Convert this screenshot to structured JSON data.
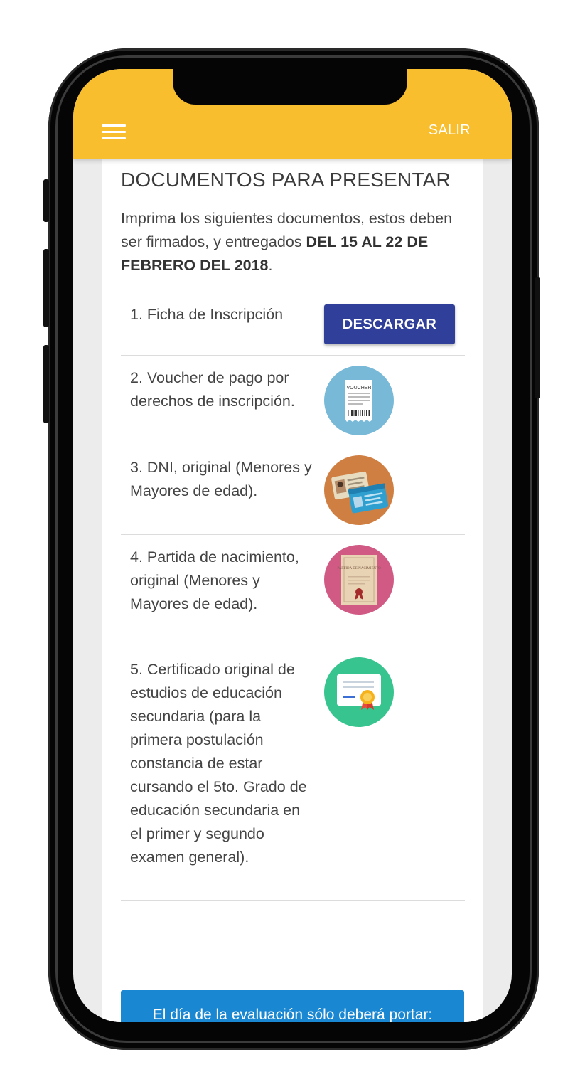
{
  "header": {
    "menu_icon": "hamburger-menu-icon",
    "logout_label": "SALIR",
    "color": "#f8be2e"
  },
  "page": {
    "title": "DOCUMENTOS PARA PRESENTAR",
    "intro_prefix": "Imprima los siguientes documentos, estos deben ser firmados, y entregados ",
    "intro_bold": "DEL 15 AL 22 DE FEBRERO DEL 2018",
    "intro_suffix": "."
  },
  "documents": [
    {
      "text": "1. Ficha de Inscripción",
      "action_label": "DESCARGAR"
    },
    {
      "text": "2. Voucher de pago por derechos de inscripción.",
      "icon": "voucher-icon",
      "icon_label": "VOUCHER"
    },
    {
      "text": "3. DNI, original (Menores y Mayores de edad).",
      "icon": "id-card-icon"
    },
    {
      "text": "4. Partida de nacimiento, original (Menores y Mayores de edad).",
      "icon": "birth-certificate-icon",
      "icon_label": "PARTIDA DE NACIMIENTO"
    },
    {
      "text": "5. Certificado original de estudios de educación secundaria (para la primera postulación constancia de estar cursando el 5to. Grado de educación secundaria en el primer y segundo examen general).",
      "icon": "certificate-icon"
    }
  ],
  "notice": {
    "text": "El día de la evaluación sólo deberá portar: DNI (original), Ficha de inscripción visada por la Oficina de Admisión, borrador y tajador.",
    "color": "#1a87d2"
  },
  "colors": {
    "button": "#2f3f9a"
  }
}
